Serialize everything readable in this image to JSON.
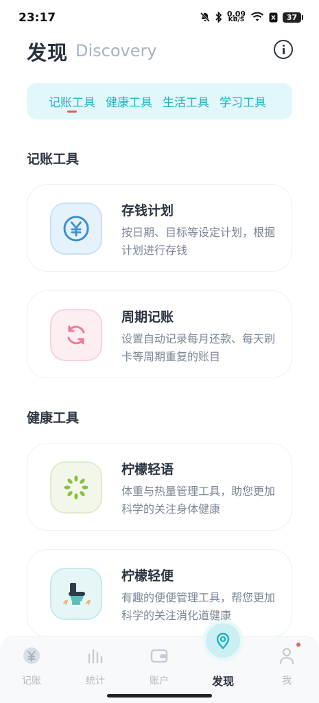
{
  "status_bar": {
    "time": "23:17",
    "net_speed": "0.09",
    "net_unit": "KB/S",
    "battery": "37"
  },
  "header": {
    "title": "发现",
    "subtitle": "Discovery"
  },
  "tabs": [
    {
      "label": "记账工具",
      "active": true
    },
    {
      "label": "健康工具",
      "active": false
    },
    {
      "label": "生活工具",
      "active": false
    },
    {
      "label": "学习工具",
      "active": false
    }
  ],
  "sections": [
    {
      "title": "记账工具",
      "cards": [
        {
          "name": "存钱计划",
          "desc": "按日期、目标等设定计划，根据计划进行存钱",
          "icon": "yen-coin-icon",
          "color": "#3a8fd6"
        },
        {
          "name": "周期记账",
          "desc": "设置自动记录每月还款、每天刷卡等周期重复的账目",
          "icon": "refresh-icon",
          "color": "#f07a93"
        }
      ]
    },
    {
      "title": "健康工具",
      "cards": [
        {
          "name": "柠檬轻语",
          "desc": "体重与热量管理工具，助您更加科学的关注身体健康",
          "icon": "spinner-leaf-icon",
          "color": "#8cbf3f"
        },
        {
          "name": "柠檬轻便",
          "desc": "有趣的便便管理工具，帮您更加科学的关注消化道健康",
          "icon": "toilet-icon",
          "color": "#5bbfb9"
        }
      ]
    }
  ],
  "nav": [
    {
      "label": "记账",
      "icon": "yen-icon",
      "active": false
    },
    {
      "label": "统计",
      "icon": "bar-chart-icon",
      "active": false
    },
    {
      "label": "账户",
      "icon": "wallet-icon",
      "active": false
    },
    {
      "label": "发现",
      "icon": "location-pin-icon",
      "active": true
    },
    {
      "label": "我",
      "icon": "person-icon",
      "active": false
    }
  ],
  "colors": {
    "accent": "#1bb3c1",
    "tab_bg": "#e2f7f9",
    "indicator": "#e45a5a"
  }
}
